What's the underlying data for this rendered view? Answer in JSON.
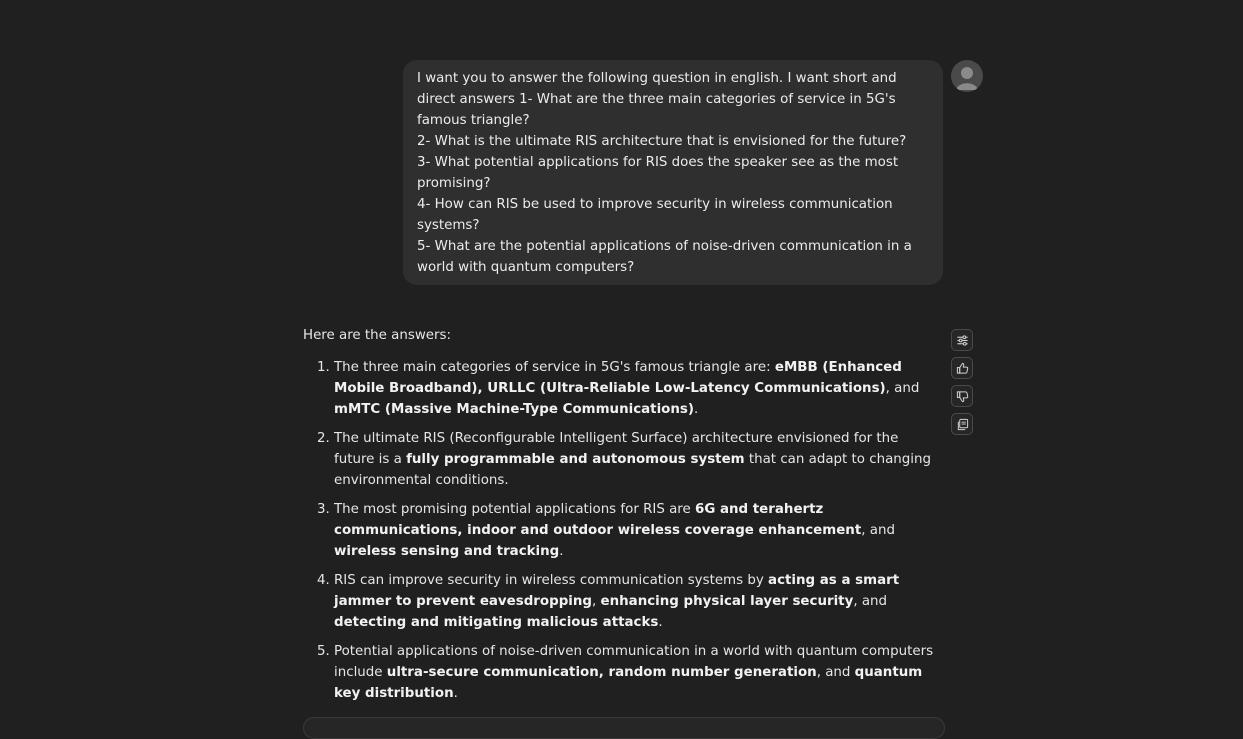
{
  "user_message": {
    "lines": [
      "I want you to answer the following question in english. I want short and direct answers 1- What are the three main categories of service in 5G's famous triangle?",
      "2- What is the ultimate RIS architecture that is envisioned for the future?",
      "3- What potential applications for RIS does the speaker see as the most promising?",
      "4- How can RIS be used to improve security in wireless communication systems?",
      "5- What are the potential applications of noise-driven communication in a world with quantum computers?"
    ]
  },
  "assistant": {
    "intro": "Here are the answers:",
    "items": [
      {
        "t1": "The three main categories of service in 5G's famous triangle are: ",
        "b1": "eMBB (Enhanced Mobile Broadband), URLLC (Ultra-Reliable Low-Latency Communications)",
        "t2": ", and ",
        "b2": "mMTC (Massive Machine-Type Communications)",
        "t3": "."
      },
      {
        "t1": "The ultimate RIS (Reconfigurable Intelligent Surface) architecture envisioned for the future is a ",
        "b1": "fully programmable and autonomous system",
        "t2": " that can adapt to changing environmental conditions."
      },
      {
        "t1": "The most promising potential applications for RIS are ",
        "b1": "6G and terahertz communications, indoor and outdoor wireless coverage enhancement",
        "t2": ", and ",
        "b2": "wireless sensing and tracking",
        "t3": "."
      },
      {
        "t1": "RIS can improve security in wireless communication systems by ",
        "b1": "acting as a smart jammer to prevent eavesdropping",
        "t2": ", ",
        "b2": "enhancing physical layer security",
        "t3": ", and ",
        "b3": "detecting and mitigating malicious attacks",
        "t4": "."
      },
      {
        "t1": "Potential applications of noise-driven communication in a world with quantum computers include ",
        "b1": "ultra-secure communication, random number generation",
        "t2": ", and ",
        "b2": "quantum key distribution",
        "t3": "."
      }
    ]
  },
  "actions": {
    "icons": [
      "settings-sliders-icon",
      "thumbs-up-icon",
      "thumbs-down-icon",
      "copy-icon"
    ]
  },
  "colors": {
    "background": "#202020",
    "bubble": "#2f2f2f",
    "text": "#e6e6e6"
  }
}
